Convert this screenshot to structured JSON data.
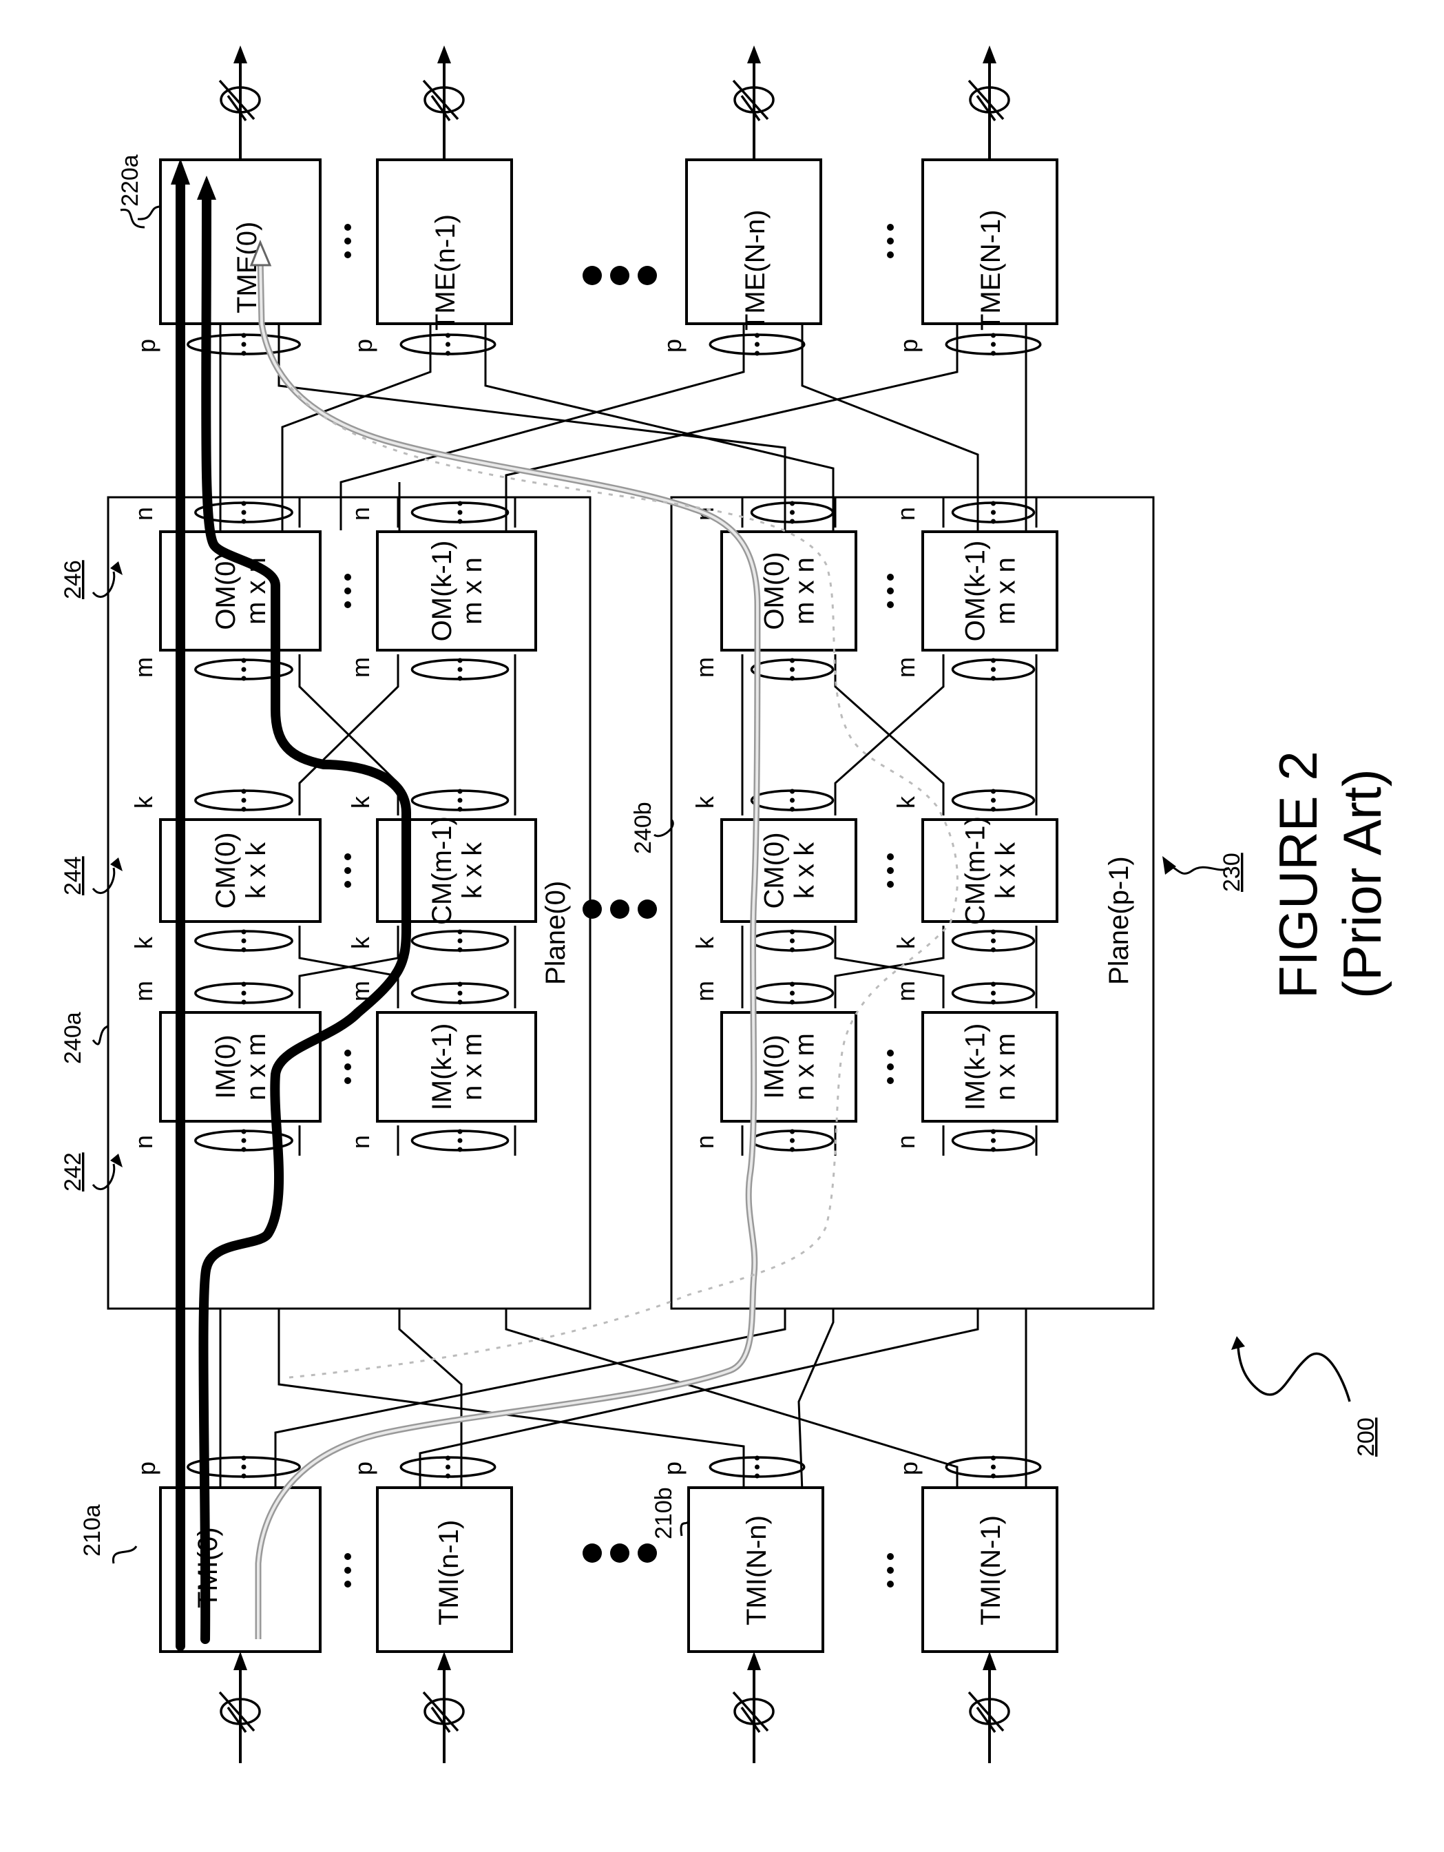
{
  "figure": {
    "title": "FIGURE 2",
    "subtitle": "(Prior Art)",
    "reference": "200"
  },
  "egress": {
    "ref": "220a",
    "modules": [
      "TME(0)",
      "TME(n-1)",
      "TME(N-n)",
      "TME(N-1)"
    ],
    "port_label": "p"
  },
  "ingress": {
    "refs": [
      "210a",
      "210b"
    ],
    "modules": [
      "TMI(0)",
      "TMI(n-1)",
      "TMI(N-n)",
      "TMI(N-1)"
    ],
    "port_label": "p"
  },
  "fabric": {
    "ref": "230",
    "stage_refs": {
      "input": "242",
      "center": "244",
      "output": "246"
    },
    "planes": [
      {
        "ref": "240a",
        "name": "Plane(0)",
        "output_modules": [
          {
            "name": "OM(0)",
            "size": "m x n"
          },
          {
            "name": "OM(k-1)",
            "size": "m x n"
          }
        ],
        "center_modules": [
          {
            "name": "CM(0)",
            "size": "k x k"
          },
          {
            "name": "CM(m-1)",
            "size": "k x k"
          }
        ],
        "input_modules": [
          {
            "name": "IM(0)",
            "size": "n x m"
          },
          {
            "name": "IM(k-1)",
            "size": "n x m"
          }
        ]
      },
      {
        "ref": "240b",
        "name": "Plane(p-1)",
        "output_modules": [
          {
            "name": "OM(0)",
            "size": "m x n"
          },
          {
            "name": "OM(k-1)",
            "size": "m x n"
          }
        ],
        "center_modules": [
          {
            "name": "CM(0)",
            "size": "k x k"
          },
          {
            "name": "CM(m-1)",
            "size": "k x k"
          }
        ],
        "input_modules": [
          {
            "name": "IM(0)",
            "size": "n x m"
          },
          {
            "name": "IM(k-1)",
            "size": "n x m"
          }
        ]
      }
    ],
    "port_labels": {
      "om_out": "n",
      "om_in": "m",
      "cm_out": "k",
      "cm_in": "k",
      "im_out": "m",
      "im_in": "n"
    }
  }
}
